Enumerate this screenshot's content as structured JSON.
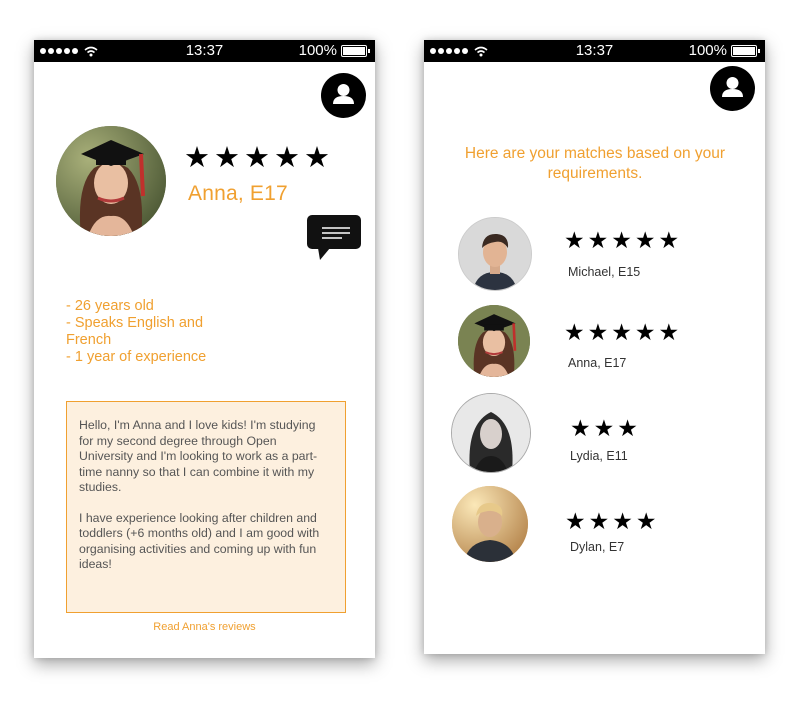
{
  "status_bar": {
    "time": "13:37",
    "battery": "100%"
  },
  "profile_screen": {
    "name": "Anna, E17",
    "rating": 5,
    "facts": [
      "- 26 years old",
      "- Speaks English and French",
      "- 1 year of experience"
    ],
    "bio_paragraphs": [
      "Hello, I'm Anna and I love kids! I'm studying for my second degree through Open University and I'm looking to work as a part-time nanny so that I can combine it with my studies.",
      "I have experience looking after children and toddlers (+6 months old) and I am good with organising activities and coming up with fun ideas!"
    ],
    "reviews_link": "Read Anna's reviews"
  },
  "matches_screen": {
    "heading": "Here are your matches based on your requirements.",
    "matches": [
      {
        "name": "Michael, E15",
        "rating": 5
      },
      {
        "name": "Anna, E17",
        "rating": 5
      },
      {
        "name": "Lydia, E11",
        "rating": 3
      },
      {
        "name": "Dylan, E7",
        "rating": 4
      }
    ]
  },
  "icons": [
    "signal-dots-icon",
    "wifi-icon",
    "battery-icon",
    "user-icon",
    "chat-bubble-icon",
    "star-icon"
  ],
  "colors": {
    "accent": "#f0a030",
    "bio_background": "#fdf0df",
    "status_bar": "#000000"
  }
}
